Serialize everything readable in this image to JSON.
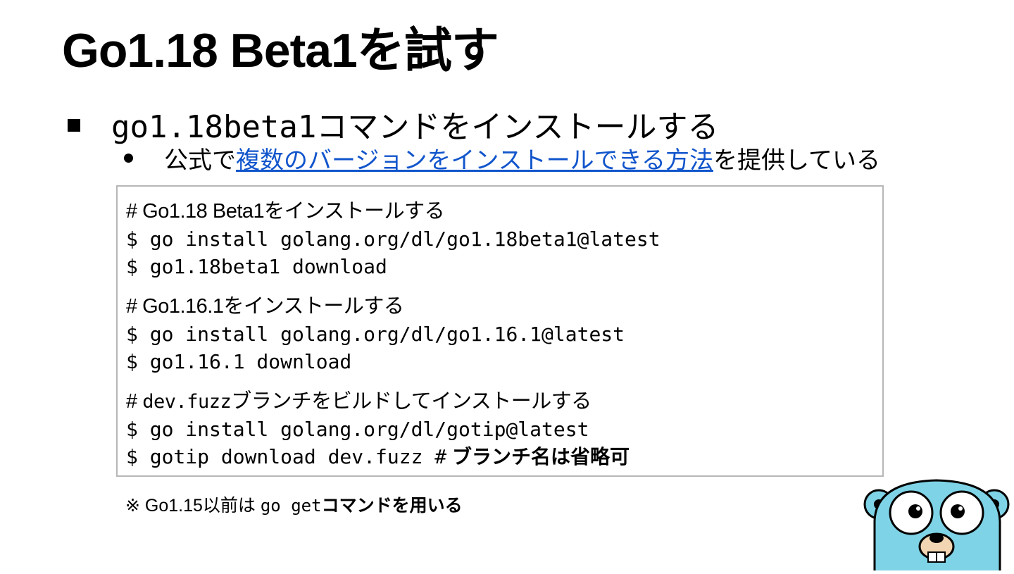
{
  "slide": {
    "title": "Go1.18 Beta1を試す",
    "bullet": "go1.18beta1コマンドをインストールする",
    "sub_prefix": "公式で",
    "sub_link": "複数のバージョンをインストールできる方法",
    "sub_suffix": "を提供している"
  },
  "code": {
    "blocks": [
      {
        "comment": "# Go1.18 Beta1をインストールする",
        "lines": [
          "$ go install golang.org/dl/go1.18beta1@latest",
          "$ go1.18beta1 download"
        ]
      },
      {
        "comment": "# Go1.16.1をインストールする",
        "lines": [
          "$ go install golang.org/dl/go1.16.1@latest",
          "$ go1.16.1 download"
        ]
      },
      {
        "comment_hash": "#",
        "comment_mono": "dev.fuzz",
        "comment_rest": "ブランチをビルドしてインストールする",
        "lines": [
          "$ go install golang.org/dl/gotip@latest"
        ],
        "last_cmd": "$ gotip download dev.fuzz #",
        "last_note": "ブランチ名は省略可"
      }
    ]
  },
  "note": {
    "prefix": "※ Go1.15以前は",
    "mono": "go get",
    "suffix": "コマンドを用いる"
  },
  "colors": {
    "link": "#1155cc",
    "box_border": "#b7b7b7",
    "gopher": "#7fd3e6"
  },
  "icons": [
    "gopher-mascot-icon"
  ]
}
